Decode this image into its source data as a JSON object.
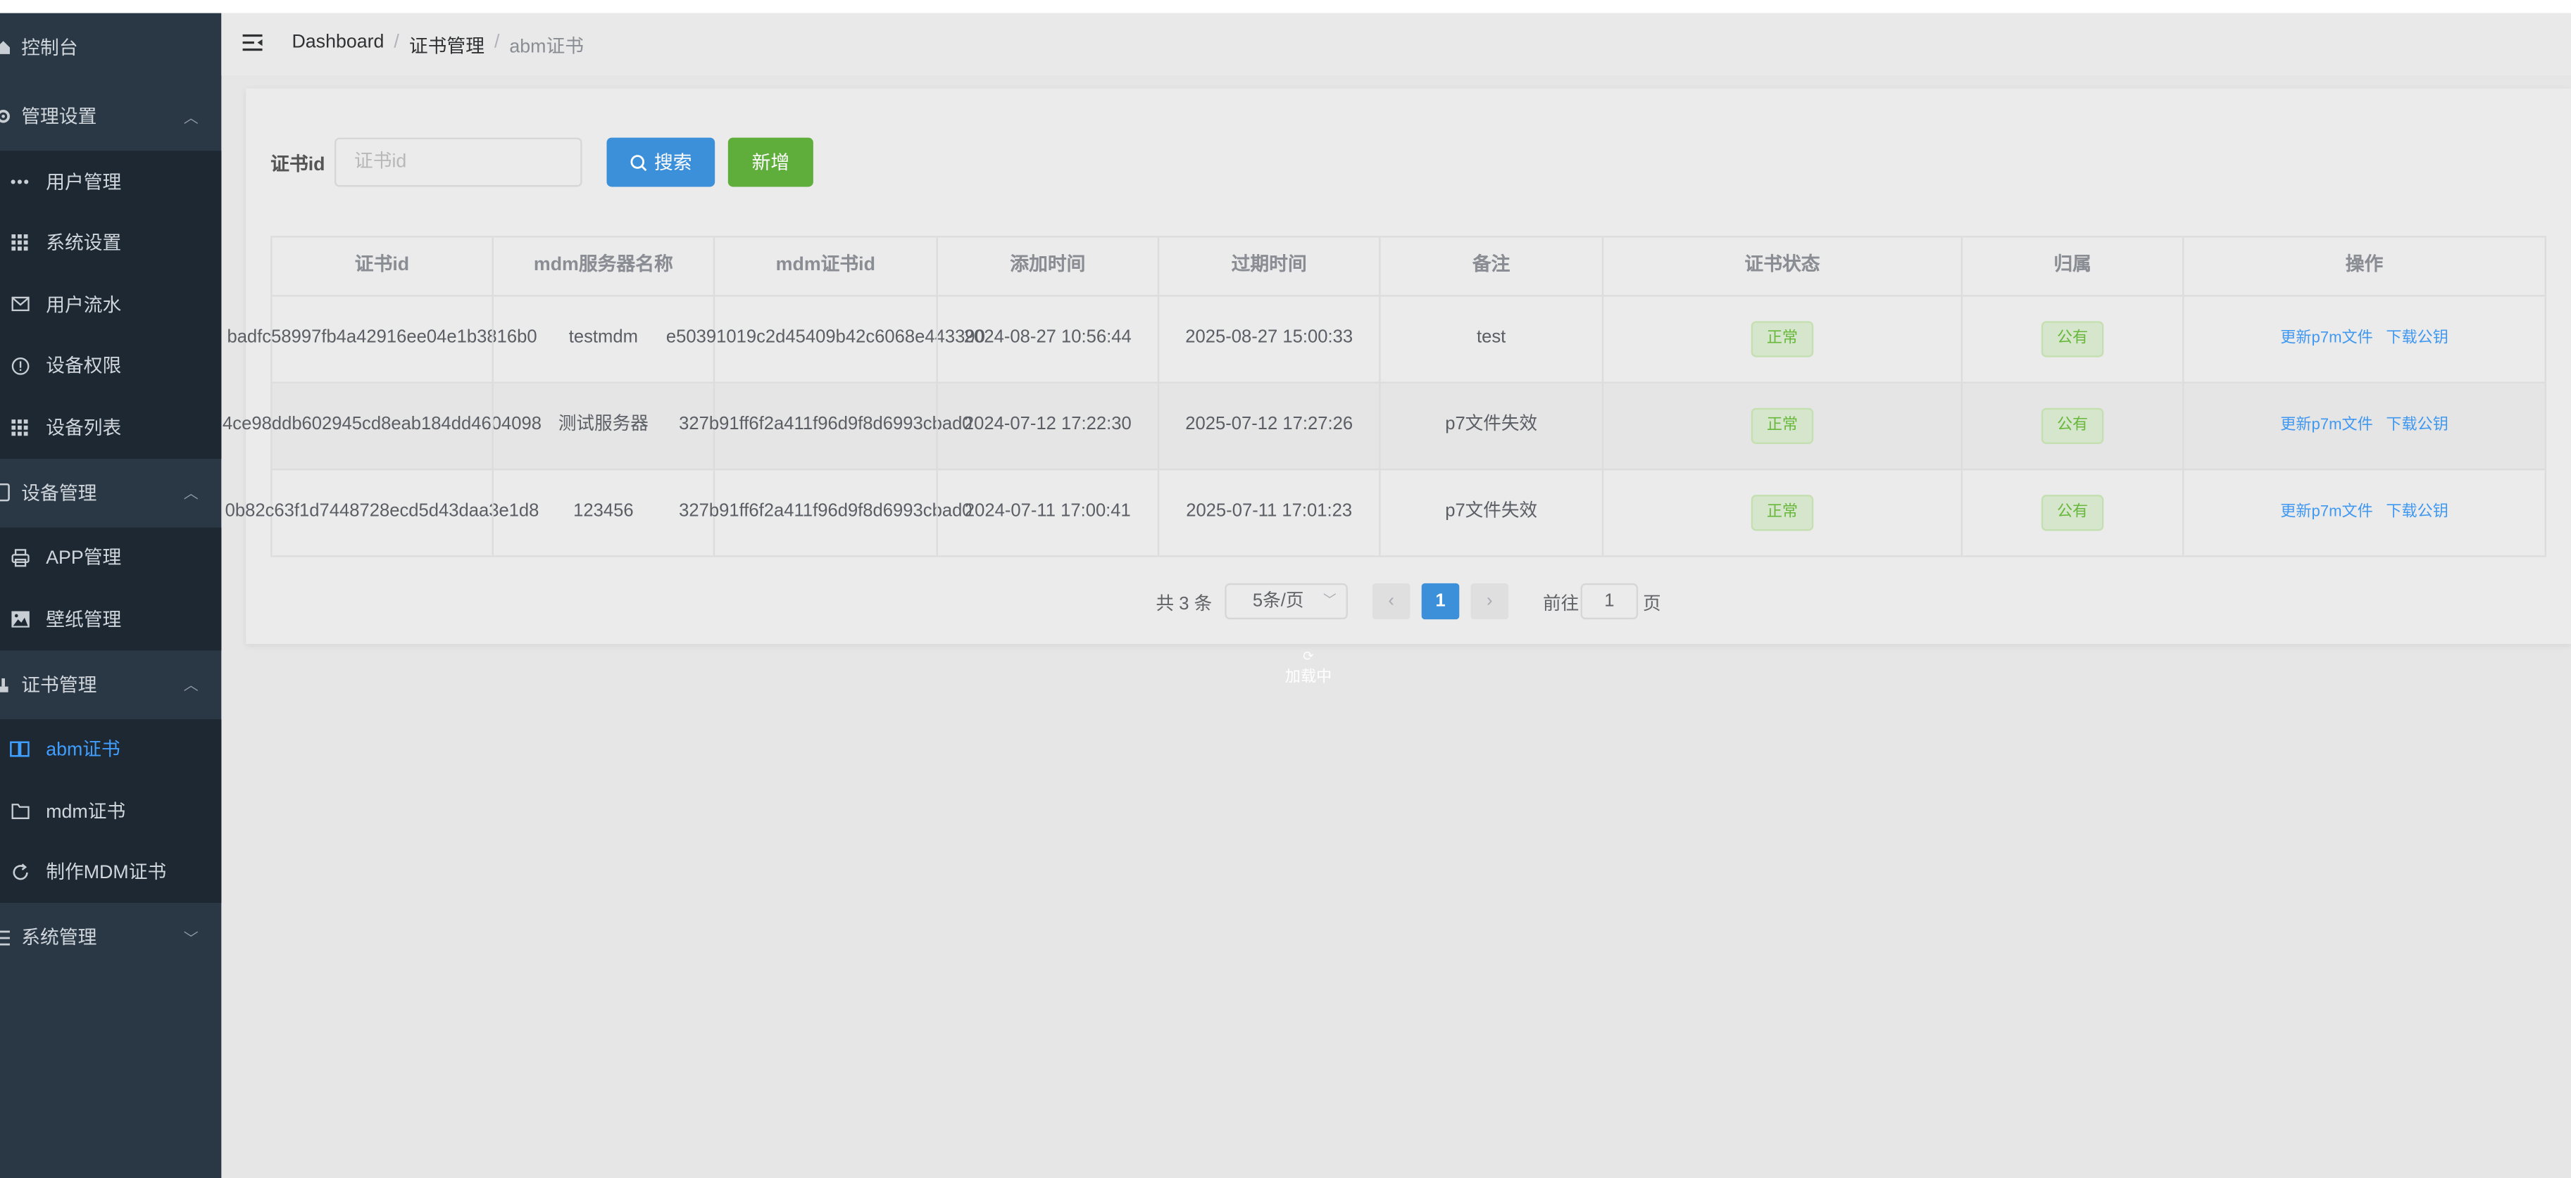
{
  "sidebar": {
    "items": [
      {
        "label": "控制台",
        "icon": "home-icon"
      },
      {
        "label": "管理设置",
        "icon": "gear-icon",
        "chevron": "︿"
      },
      {
        "label": "用户管理",
        "icon": "more-icon"
      },
      {
        "label": "系统设置",
        "icon": "grid-icon"
      },
      {
        "label": "用户流水",
        "icon": "mail-icon"
      },
      {
        "label": "设备权限",
        "icon": "info-icon"
      },
      {
        "label": "设备列表",
        "icon": "grid-icon"
      },
      {
        "label": "设备管理",
        "icon": "device-icon",
        "chevron": "︿"
      },
      {
        "label": "APP管理",
        "icon": "printer-icon"
      },
      {
        "label": "壁纸管理",
        "icon": "picture-icon"
      },
      {
        "label": "证书管理",
        "icon": "cert-icon",
        "chevron": "︿"
      },
      {
        "label": "abm证书",
        "icon": "book-icon"
      },
      {
        "label": "mdm证书",
        "icon": "folder-icon"
      },
      {
        "label": "制作MDM证书",
        "icon": "refresh-icon"
      },
      {
        "label": "系统管理",
        "icon": "menu-icon",
        "chevron": "﹀"
      }
    ]
  },
  "header": {
    "breadcrumb": [
      "Dashboard",
      "证书管理",
      "abm证书"
    ]
  },
  "search": {
    "label": "证书id",
    "placeholder": "证书id",
    "search_button": "搜索",
    "add_button": "新增"
  },
  "table": {
    "columns": [
      "证书id",
      "mdm服务器名称",
      "mdm证书id",
      "添加时间",
      "过期时间",
      "备注",
      "证书状态",
      "归属",
      "操作"
    ],
    "rows": [
      {
        "cert_id": "badfc58997fb4a42916ee04e1b3816b0",
        "server_name": "testmdm",
        "mdm_cert_id": "e50391019c2d45409b42c6068e443390",
        "added": "2024-08-27 10:56:44",
        "expires": "2025-08-27 15:00:33",
        "note": "test",
        "status": "正常",
        "owner": "公有",
        "op_update": "更新p7m文件",
        "op_download": "下载公钥"
      },
      {
        "cert_id": "4ce98ddb602945cd8eab184dd4604098",
        "server_name": "测试服务器",
        "mdm_cert_id": "327b91ff6f2a411f96d9f8d6993cbad0",
        "added": "2024-07-12 17:22:30",
        "expires": "2025-07-12 17:27:26",
        "note": "p7文件失效",
        "status": "正常",
        "owner": "公有",
        "op_update": "更新p7m文件",
        "op_download": "下载公钥"
      },
      {
        "cert_id": "0b82c63f1d7448728ecd5d43daa3e1d8",
        "server_name": "123456",
        "mdm_cert_id": "327b91ff6f2a411f96d9f8d6993cbad0",
        "added": "2024-07-11 17:00:41",
        "expires": "2025-07-11 17:01:23",
        "note": "p7文件失效",
        "status": "正常",
        "owner": "公有",
        "op_update": "更新p7m文件",
        "op_download": "下载公钥"
      }
    ]
  },
  "pagination": {
    "total": "共 3 条",
    "page_size": "5条/页",
    "current_page": "1",
    "goto_label": "前往",
    "goto_value": "1",
    "page_suffix": "页"
  },
  "loading_text": "加载中",
  "colors": {
    "sidebar_bg": "#2a3845",
    "primary": "#3c8fd9",
    "success": "#5fae3b",
    "link": "#4098f0",
    "active_menu": "#409eff"
  }
}
